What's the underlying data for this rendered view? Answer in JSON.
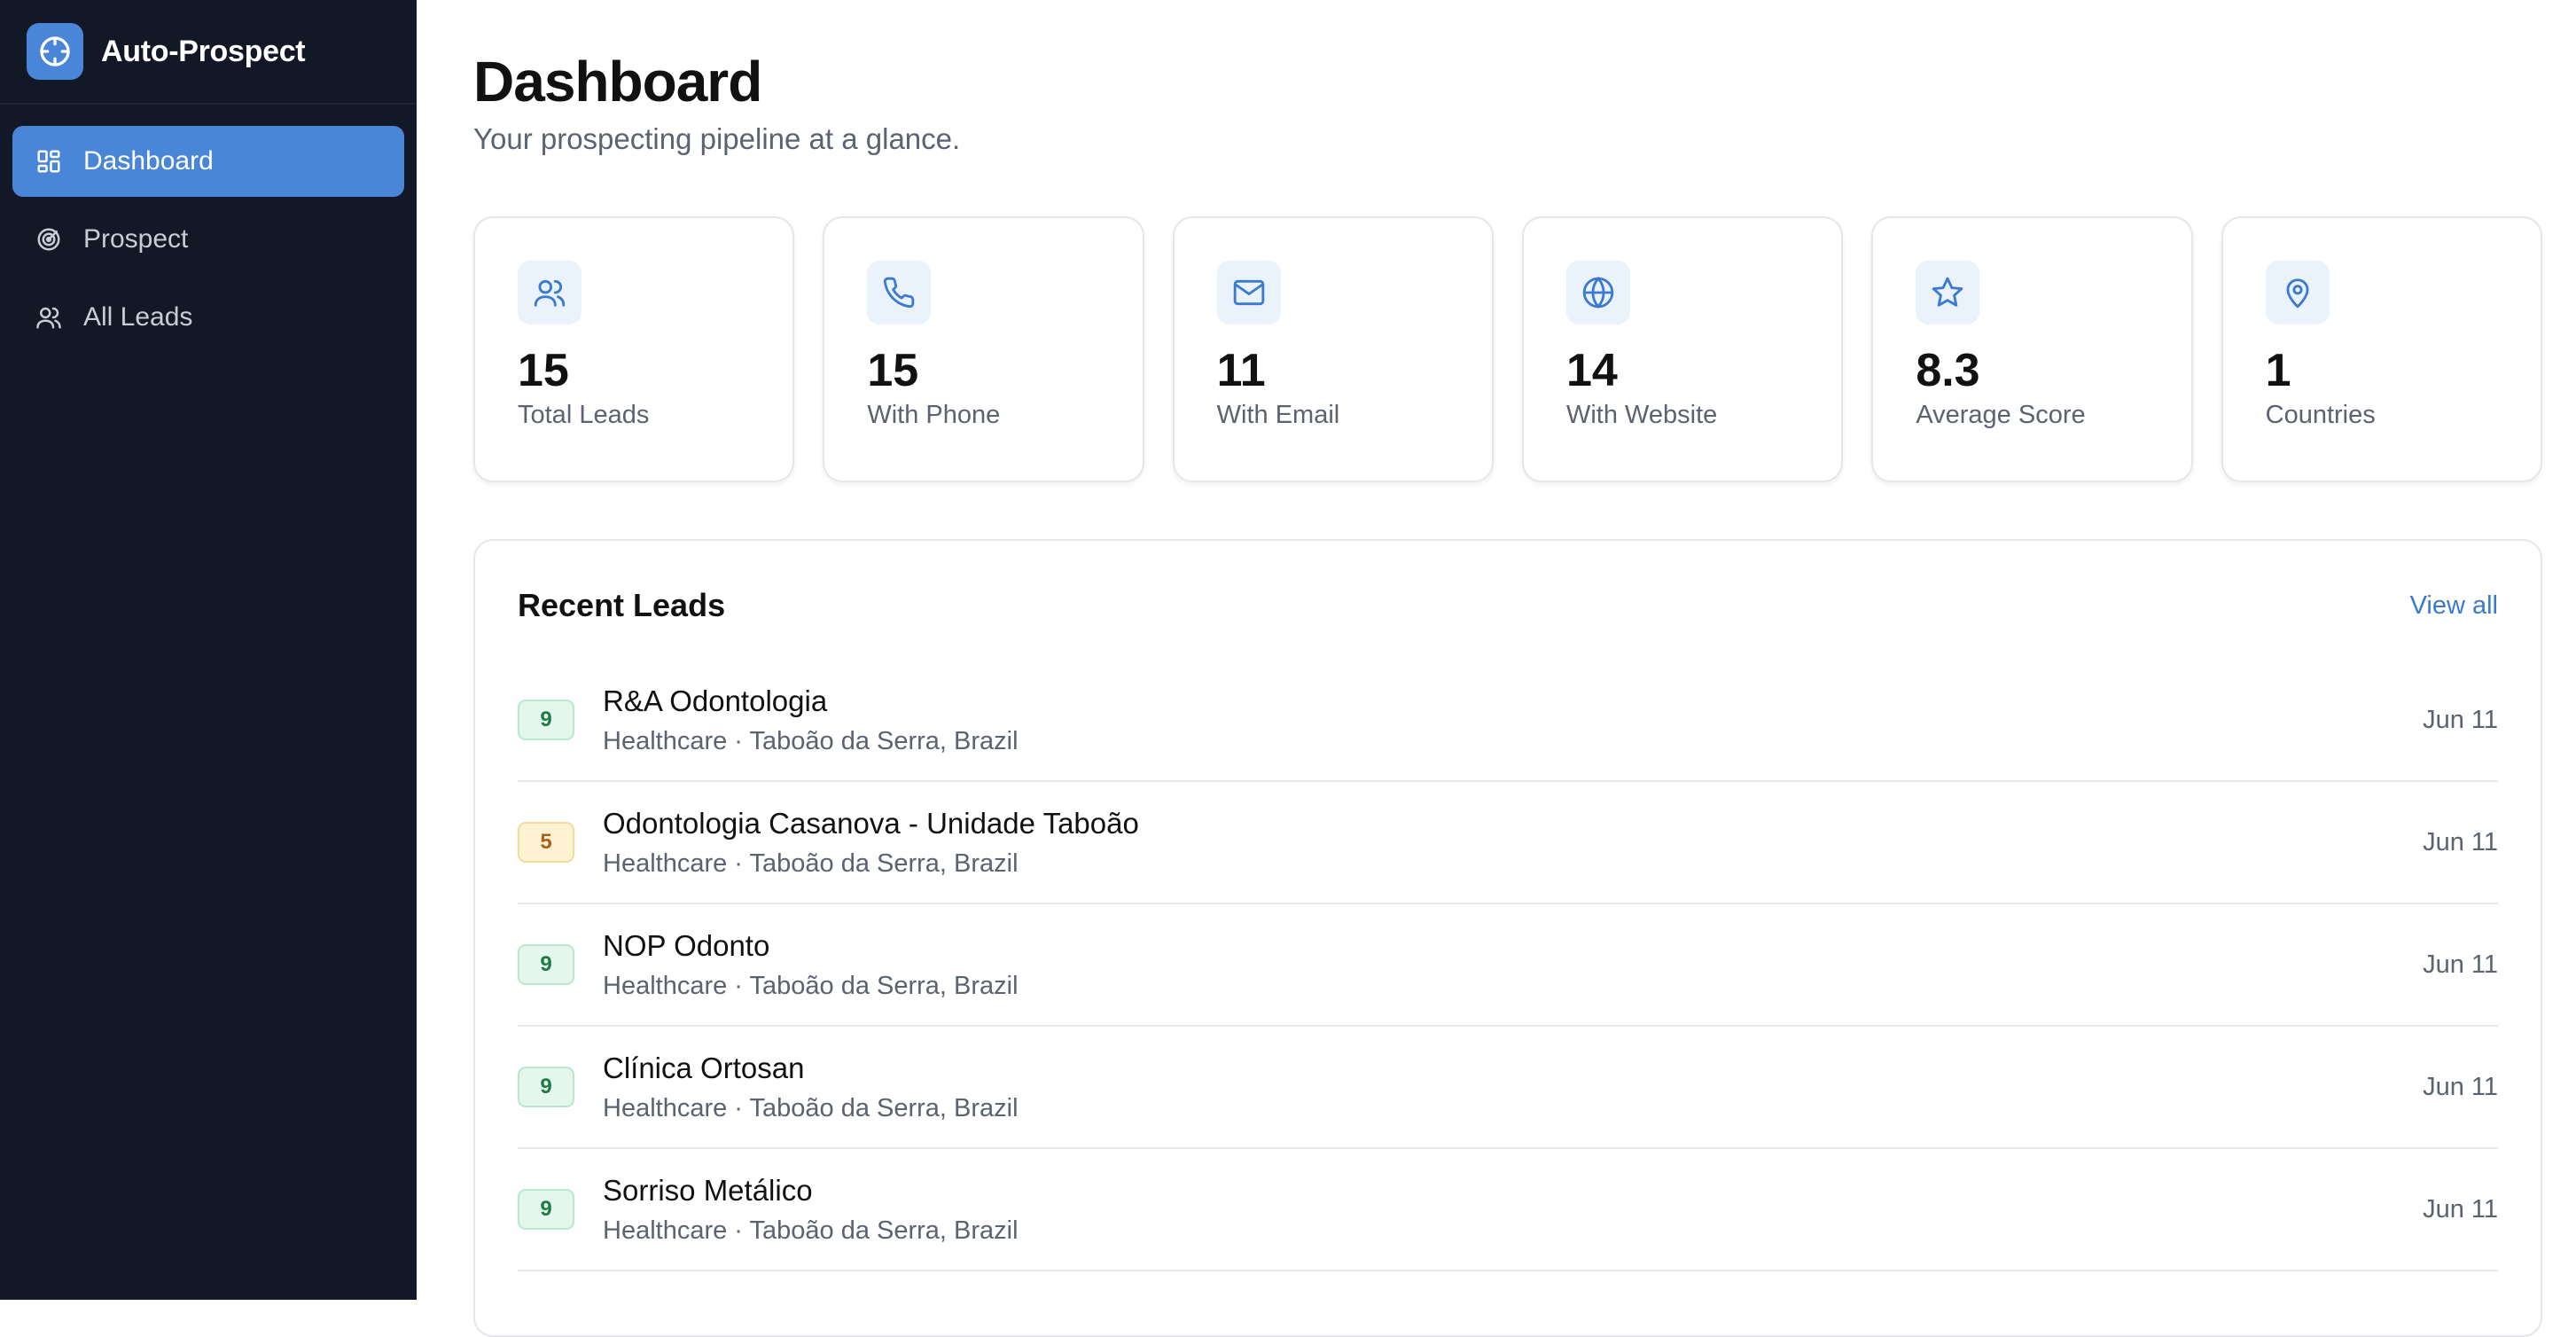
{
  "app": {
    "name": "Auto-Prospect",
    "accent": "#4a86d8",
    "sidebar_bg": "#121826"
  },
  "nav": {
    "items": [
      {
        "label": "Dashboard",
        "icon": "layout-grid-icon",
        "active": true
      },
      {
        "label": "Prospect",
        "icon": "radar-icon",
        "active": false
      },
      {
        "label": "All Leads",
        "icon": "users-icon",
        "active": false
      }
    ]
  },
  "page": {
    "title": "Dashboard",
    "subtitle": "Your prospecting pipeline at a glance."
  },
  "stats": [
    {
      "value": "15",
      "label": "Total Leads",
      "icon": "users-icon"
    },
    {
      "value": "15",
      "label": "With Phone",
      "icon": "phone-icon"
    },
    {
      "value": "11",
      "label": "With Email",
      "icon": "mail-icon"
    },
    {
      "value": "14",
      "label": "With Website",
      "icon": "globe-icon"
    },
    {
      "value": "8.3",
      "label": "Average Score",
      "icon": "star-icon"
    },
    {
      "value": "1",
      "label": "Countries",
      "icon": "map-pin-icon"
    }
  ],
  "recent": {
    "title": "Recent Leads",
    "view_all": "View all",
    "leads": [
      {
        "score": "9",
        "name": "R&A Odontologia",
        "meta": "Healthcare · Taboão da Serra, Brazil",
        "date": "Jun 11"
      },
      {
        "score": "5",
        "name": "Odontologia Casanova - Unidade Taboão",
        "meta": "Healthcare · Taboão da Serra, Brazil",
        "date": "Jun 11"
      },
      {
        "score": "9",
        "name": "NOP Odonto",
        "meta": "Healthcare · Taboão da Serra, Brazil",
        "date": "Jun 11"
      },
      {
        "score": "9",
        "name": "Clínica Ortosan",
        "meta": "Healthcare · Taboão da Serra, Brazil",
        "date": "Jun 11"
      },
      {
        "score": "9",
        "name": "Sorriso Metálico",
        "meta": "Healthcare · Taboão da Serra, Brazil",
        "date": "Jun 11"
      }
    ]
  }
}
